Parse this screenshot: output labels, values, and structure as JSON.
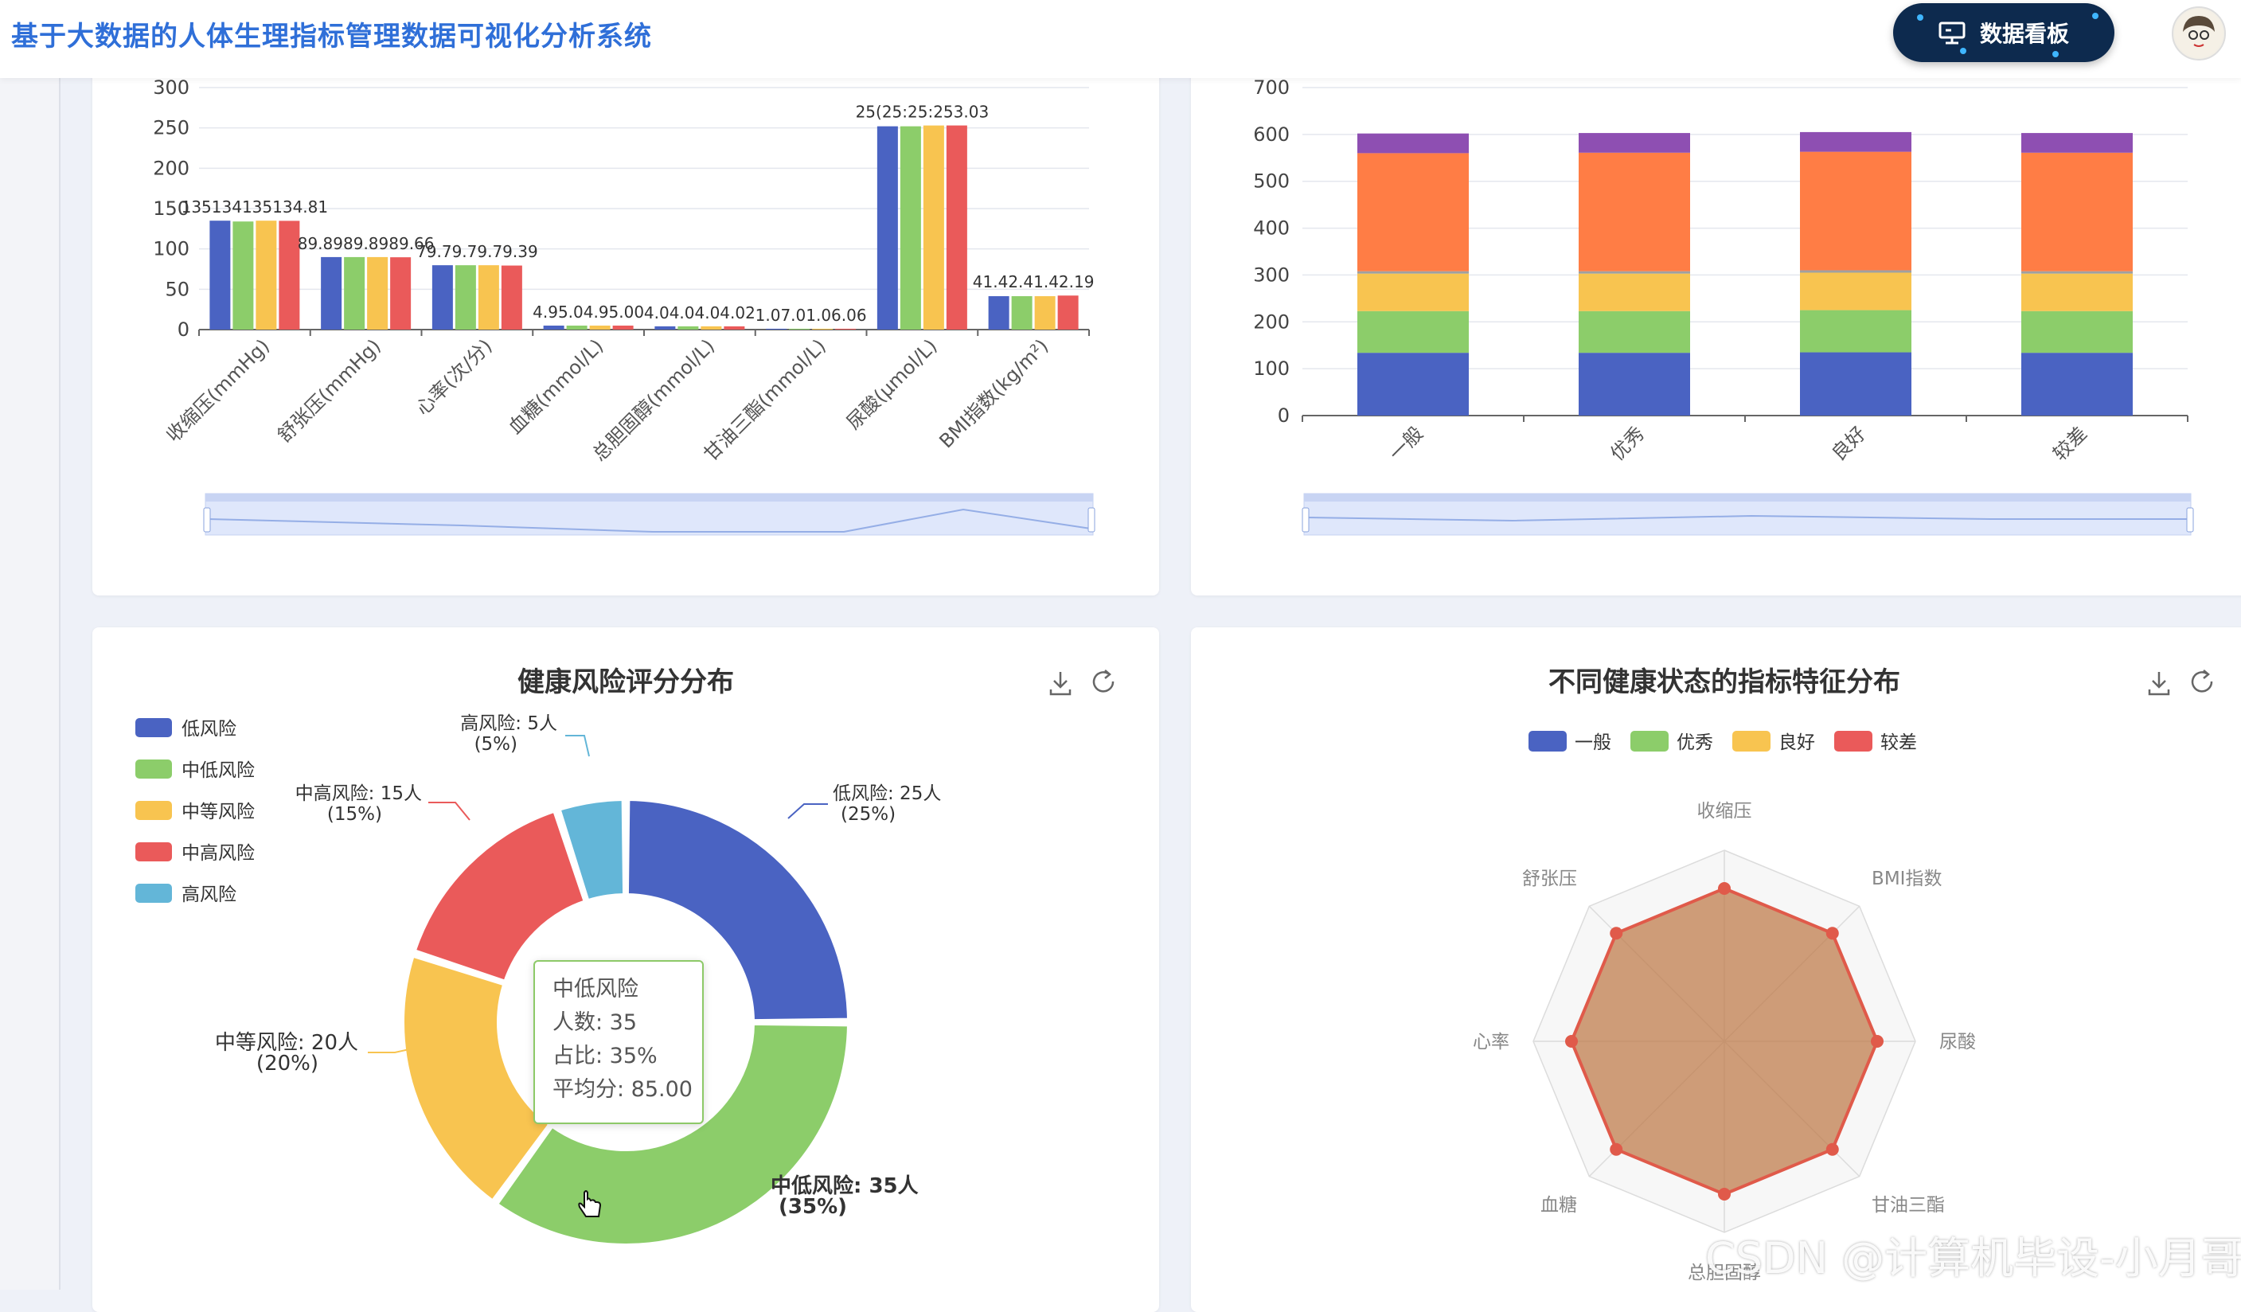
{
  "header": {
    "title": "基于大数据的人体生理指标管理数据可视化分析系统",
    "dashboard_button": "数据看板"
  },
  "top_left_chart": {
    "type": "bar",
    "categories": [
      "收缩压(mmHg)",
      "舒张压(mmHg)",
      "心率(次/分)",
      "血糖(mmol/L)",
      "总胆固醇(mmol/L)",
      "甘油三酯(mmol/L)",
      "尿酸(μmol/L)",
      "BMI指数(kg/m²)"
    ],
    "yticks": [
      "0",
      "50",
      "100",
      "150",
      "200",
      "250",
      "300"
    ],
    "ylim": [
      0,
      300
    ],
    "series_colors": [
      "#4a63c2",
      "#8ccd6a",
      "#f8c450",
      "#ea5a5a"
    ],
    "values": [
      [
        135,
        134,
        135,
        134.81
      ],
      [
        89.89,
        89.89,
        89.89,
        89.66
      ],
      [
        79.79,
        79.79,
        79.79,
        79.39
      ],
      [
        4.95,
        4.95,
        4.95,
        4.95
      ],
      [
        4.04,
        4.04,
        4.04,
        4.02
      ],
      [
        1.07,
        1.07,
        1.06,
        1.06
      ],
      [
        252,
        252,
        253,
        253.03
      ],
      [
        41.42,
        41.42,
        41.42,
        42.19
      ]
    ],
    "value_labels": [
      "135134135134.81",
      "89.8989.8989.66",
      "79.79.79.79.39",
      "4.95.04.95.00",
      "4.04.04.04.02",
      "1.07.01.06.06",
      "25(25:25:253.03",
      "41.42.41.42.19"
    ]
  },
  "top_right_chart": {
    "type": "bar",
    "stacked": true,
    "categories": [
      "一般",
      "优秀",
      "良好",
      "较差"
    ],
    "yticks": [
      "0",
      "100",
      "200",
      "300",
      "400",
      "500",
      "600",
      "700"
    ],
    "ylim": [
      0,
      700
    ],
    "segment_colors": [
      "#4a63c2",
      "#8ccd6a",
      "#f8c450",
      "#a0a0a0",
      "#ff7d45",
      "#8e4fb2"
    ],
    "stack_values": [
      [
        134,
        89,
        80,
        5,
        252,
        42
      ],
      [
        134,
        89,
        80,
        5,
        253,
        42
      ],
      [
        135,
        90,
        80,
        5,
        253,
        42
      ],
      [
        134,
        89,
        80,
        5,
        253,
        42
      ]
    ]
  },
  "pie_card": {
    "title": "健康风险评分分布",
    "legend": [
      {
        "name": "低风险",
        "color": "#4a63c2"
      },
      {
        "name": "中低风险",
        "color": "#8ccd6a"
      },
      {
        "name": "中等风险",
        "color": "#f8c450"
      },
      {
        "name": "中高风险",
        "color": "#ea5a5a"
      },
      {
        "name": "高风险",
        "color": "#63b6d8"
      }
    ],
    "chart_data": {
      "type": "pie",
      "slices": [
        {
          "name": "低风险",
          "value": 25,
          "percent": 25
        },
        {
          "name": "中低风险",
          "value": 35,
          "percent": 35
        },
        {
          "name": "中等风险",
          "value": 20,
          "percent": 20
        },
        {
          "name": "中高风险",
          "value": 15,
          "percent": 15
        },
        {
          "name": "高风险",
          "value": 5,
          "percent": 5
        }
      ]
    },
    "labels": [
      {
        "line1": "低风险: 25人",
        "line2": "(25%)"
      },
      {
        "line1": "中低风险: 35人",
        "line2": "(35%)"
      },
      {
        "line1": "中等风险: 20人",
        "line2": "(20%)"
      },
      {
        "line1": "中高风险: 15人",
        "line2": "(15%)"
      },
      {
        "line1": "高风险: 5人",
        "line2": "(5%)"
      }
    ],
    "tooltip": {
      "title": "中低风险",
      "count": "人数: 35",
      "ratio": "占比: 35%",
      "avg": "平均分: 85.00"
    }
  },
  "radar_card": {
    "title": "不同健康状态的指标特征分布",
    "legend": [
      {
        "name": "一般",
        "color": "#4a63c2"
      },
      {
        "name": "优秀",
        "color": "#8ccd6a"
      },
      {
        "name": "良好",
        "color": "#f8c450"
      },
      {
        "name": "较差",
        "color": "#ea5a5a"
      }
    ],
    "chart_data": {
      "type": "radar",
      "indicators": [
        "收缩压",
        "BMI指数",
        "尿酸",
        "甘油三酯",
        "总胆固醇",
        "血糖",
        "心率",
        "舒张压"
      ],
      "series": [
        {
          "values": [
            0.8,
            0.8,
            0.8,
            0.8,
            0.8,
            0.8,
            0.8,
            0.8
          ]
        }
      ]
    }
  },
  "watermark": "CSDN @计算机毕设-小月哥"
}
